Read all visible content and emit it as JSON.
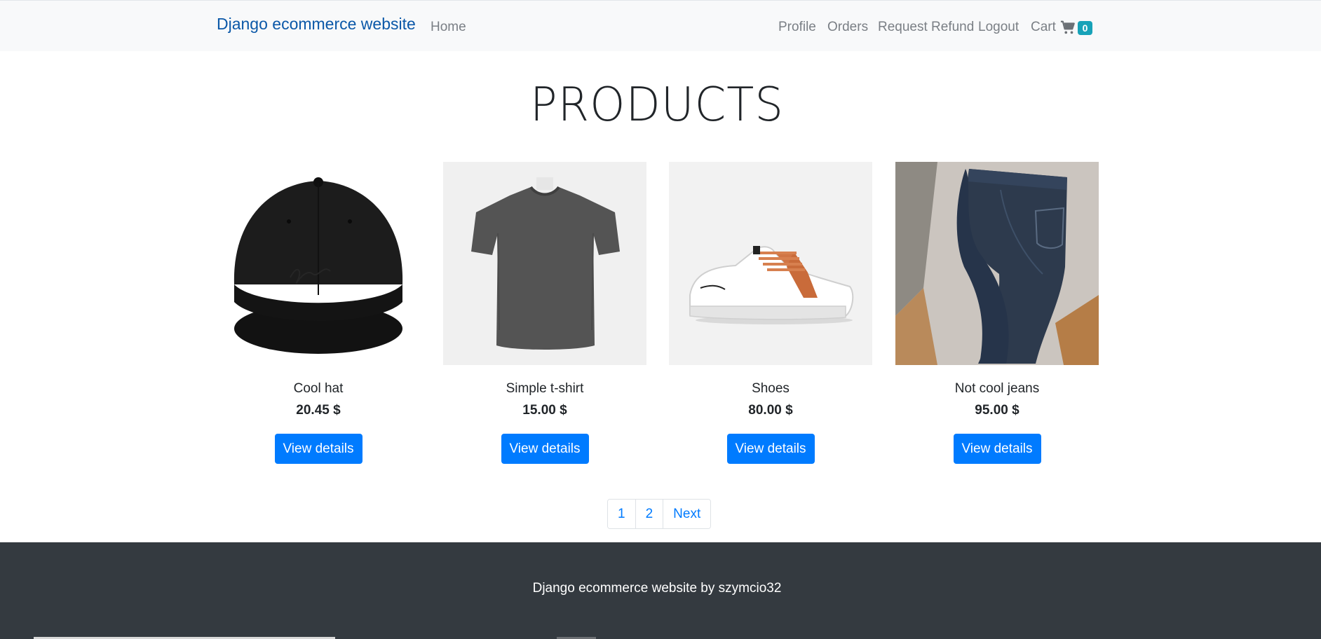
{
  "navbar": {
    "brand": "Django ecommerce website",
    "home": "Home",
    "profile": "Profile",
    "orders": "Orders",
    "refund": "Request Refund",
    "logout": "Logout",
    "cart": "Cart",
    "cart_count": "0",
    "cart_icon": "shopping-cart-icon"
  },
  "main": {
    "title": "PRODUCTS",
    "products": [
      {
        "name": "Cool hat",
        "price": "20.45 $",
        "button": "View details",
        "image": "black-cap"
      },
      {
        "name": "Simple t-shirt",
        "price": "15.00 $",
        "button": "View details",
        "image": "grey-tshirt"
      },
      {
        "name": "Shoes",
        "price": "80.00 $",
        "button": "View details",
        "image": "white-sneaker"
      },
      {
        "name": "Not cool jeans",
        "price": "95.00 $",
        "button": "View details",
        "image": "dark-jeans"
      }
    ]
  },
  "pagination": {
    "pages": [
      "1",
      "2"
    ],
    "next": "Next"
  },
  "footer": {
    "text": "Django ecommerce website by szymcio32"
  },
  "colors": {
    "brand": "#0b58a8",
    "primary": "#007bff",
    "badge": "#17a2b8",
    "footer_bg": "#343a40",
    "navbar_bg": "#f8f9fa"
  }
}
